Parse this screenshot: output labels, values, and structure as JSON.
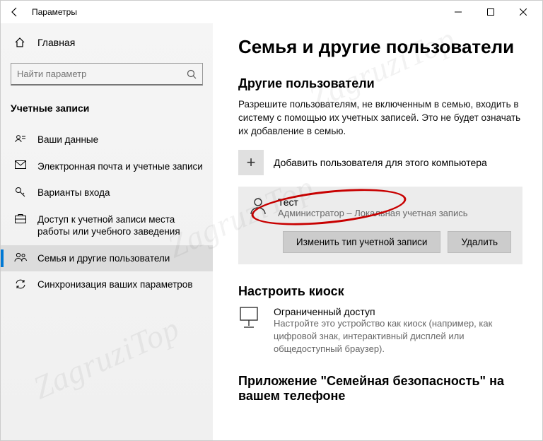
{
  "window": {
    "title": "Параметры"
  },
  "sidebar": {
    "home": "Главная",
    "searchPlaceholder": "Найти параметр",
    "category": "Учетные записи",
    "items": [
      {
        "label": "Ваши данные"
      },
      {
        "label": "Электронная почта и учетные записи"
      },
      {
        "label": "Варианты входа"
      },
      {
        "label": "Доступ к учетной записи места работы или учебного заведения"
      },
      {
        "label": "Семья и другие пользователи"
      },
      {
        "label": "Синхронизация ваших параметров"
      }
    ]
  },
  "main": {
    "heading": "Семья и другие пользователи",
    "section1": {
      "title": "Другие пользователи",
      "desc": "Разрешите пользователям, не включенным в семью, входить в систему с помощью их учетных записей. Это не будет означать их добавление в семью.",
      "addLabel": "Добавить пользователя для этого компьютера",
      "user": {
        "name": "Тест",
        "subtitle": "Администратор – Локальная учетная запись",
        "changeBtn": "Изменить тип учетной записи",
        "removeBtn": "Удалить"
      }
    },
    "section2": {
      "title": "Настроить киоск",
      "kioskTitle": "Ограниченный доступ",
      "kioskDesc": "Настройте это устройство как киоск (например, как цифровой знак, интерактивный дисплей или общедоступный браузер)."
    },
    "section3": {
      "title": "Приложение \"Семейная безопасность\" на вашем телефоне"
    }
  },
  "watermark": "ZagruziTop"
}
